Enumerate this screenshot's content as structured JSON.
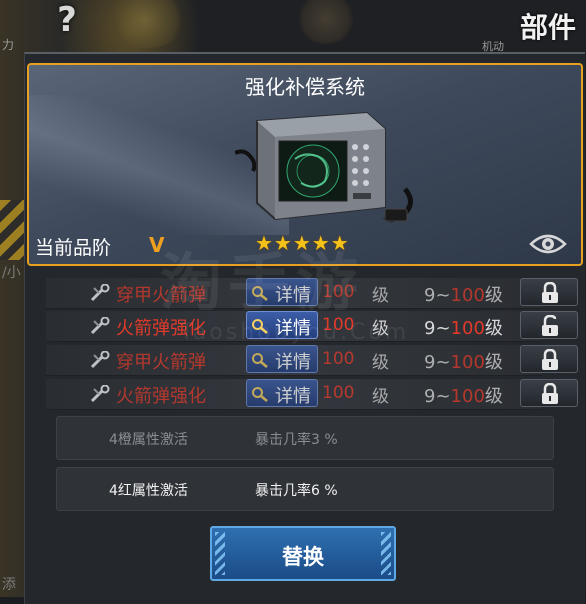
{
  "background": {
    "side_text_top": "力",
    "side_text_right": "机动",
    "side_text_mid": "/小",
    "side_text_bottom": "添"
  },
  "header": {
    "title": "部件",
    "help_icon": "question-icon"
  },
  "item": {
    "name": "强化补偿系统",
    "quality_label": "当前品阶",
    "quality_value": "V",
    "stars": "★★★★★",
    "star_count": 5,
    "frame_color": "#e8a020"
  },
  "attributes": [
    {
      "name": "穿甲火箭弹",
      "detail_label": "详情",
      "level": "100",
      "level_unit": "级",
      "range_low": "9~",
      "range_high": "100",
      "range_unit": "级",
      "locked": true
    },
    {
      "name": "火箭弹强化",
      "detail_label": "详情",
      "level": "100",
      "level_unit": "级",
      "range_low": "9~",
      "range_high": "100",
      "range_unit": "级",
      "locked": false
    },
    {
      "name": "穿甲火箭弹",
      "detail_label": "详情",
      "level": "100",
      "level_unit": "级",
      "range_low": "9~",
      "range_high": "100",
      "range_unit": "级",
      "locked": true
    },
    {
      "name": "火箭弹强化",
      "detail_label": "详情",
      "level": "100",
      "level_unit": "级",
      "range_low": "9~",
      "range_high": "100",
      "range_unit": "级",
      "locked": true
    }
  ],
  "set_bonuses": [
    {
      "name": "4橙属性激活",
      "value": "暴击几率3 %",
      "active": false
    },
    {
      "name": "4红属性激活",
      "value": "暴击几率6 %",
      "active": true
    }
  ],
  "actions": {
    "replace_label": "替换"
  },
  "watermark": {
    "main": "淘手游",
    "sub": "Taoshouyou.Com"
  },
  "colors": {
    "attribute_red": "#e03a2a",
    "quality_orange": "#f0a020",
    "star_gold": "#f5c21a",
    "button_blue": "#2f6fb0"
  }
}
